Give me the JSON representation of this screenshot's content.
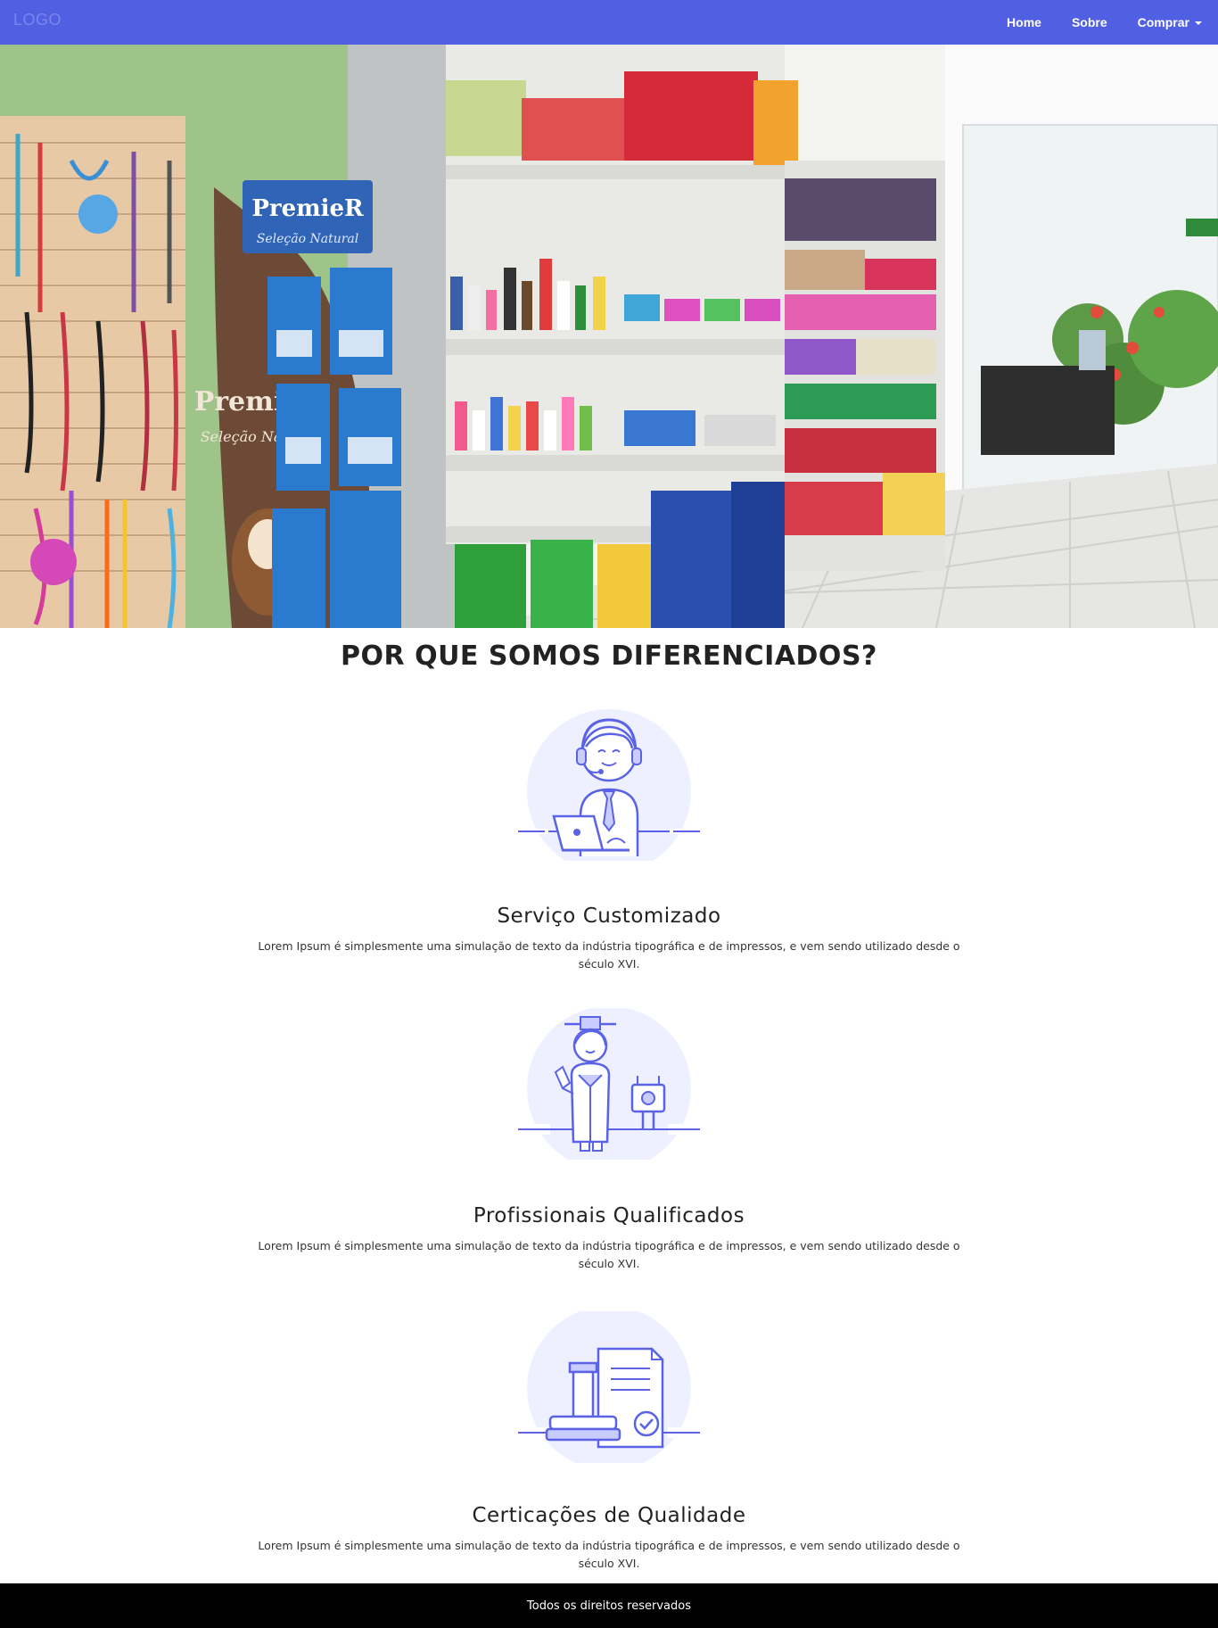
{
  "navbar": {
    "logo": "LOGO",
    "links": [
      {
        "label": "Home"
      },
      {
        "label": "Sobre"
      },
      {
        "label": "Comprar"
      }
    ]
  },
  "hero": {
    "signs": {
      "brand_top": "PremieR",
      "brand_top_sub": "Seleção Natural",
      "brand_side": "PremieR",
      "brand_side_sub": "Seleção Natural"
    }
  },
  "section": {
    "title": "POR QUE SOMOS DIFERENCIADOS?"
  },
  "features": [
    {
      "icon": "customer-support-icon",
      "title": "Serviço Customizado",
      "text": "Lorem Ipsum é simplesmente uma simulação de texto da indústria tipográfica e de impressos, e vem sendo utilizado desde o século XVI."
    },
    {
      "icon": "graduate-professional-icon",
      "title": "Profissionais Qualificados",
      "text": "Lorem Ipsum é simplesmente uma simulação de texto da indústria tipográfica e de impressos, e vem sendo utilizado desde o século XVI."
    },
    {
      "icon": "certificate-stamp-icon",
      "title": "Certicações de Qualidade",
      "text": "Lorem Ipsum é simplesmente uma simulação de texto da indústria tipográfica e de impressos, e vem sendo utilizado desde o século XVI."
    }
  ],
  "colors": {
    "navbar": "#5160e3",
    "accent": "#5a63e6",
    "icon_circle": "#eef0ff",
    "footer": "#000000"
  },
  "footer": {
    "text": "Todos os direitos reservados"
  }
}
